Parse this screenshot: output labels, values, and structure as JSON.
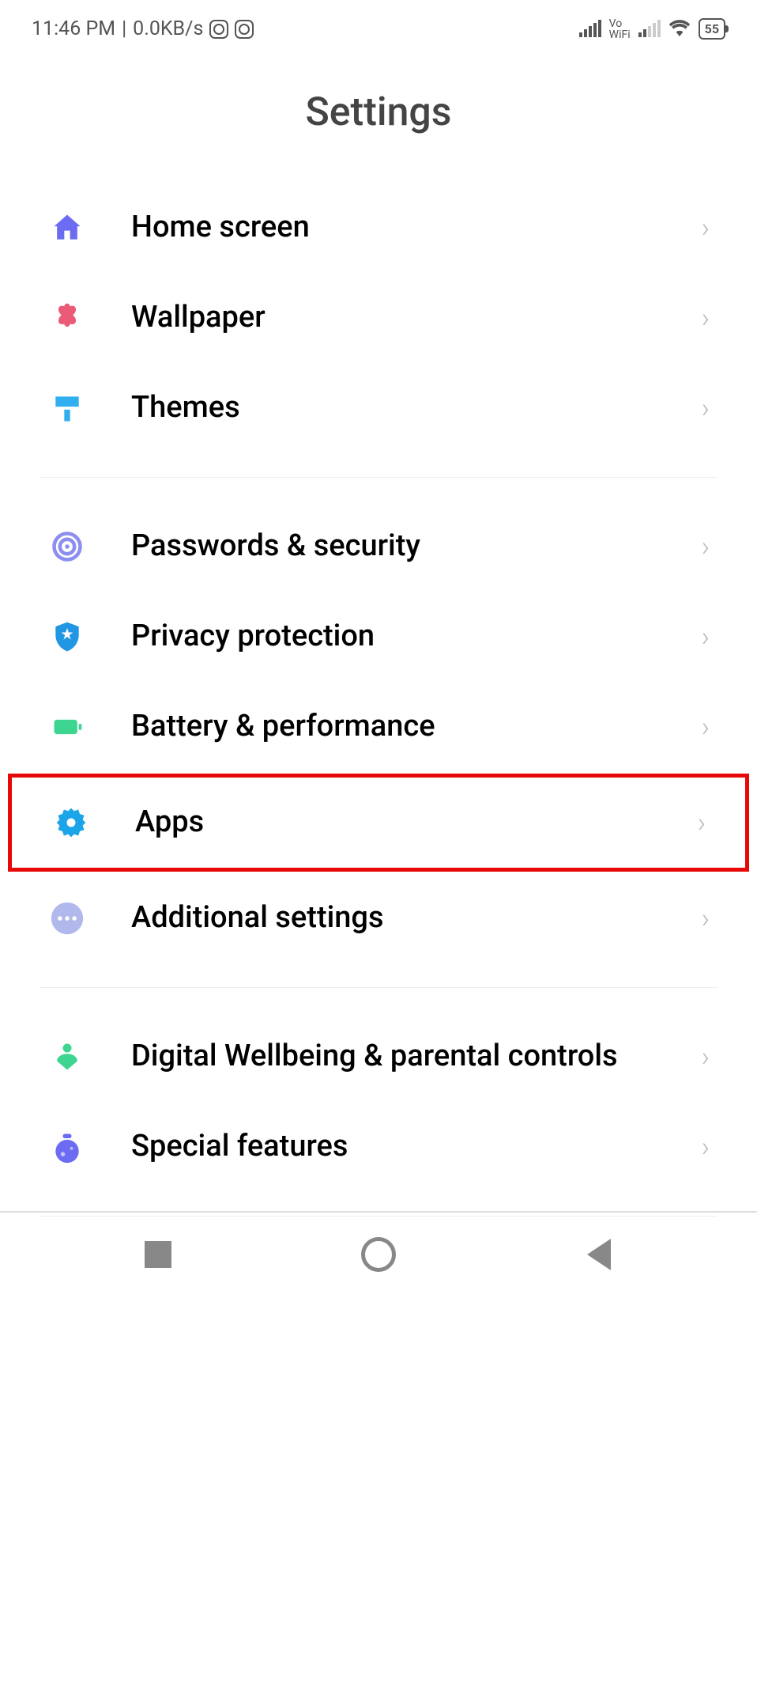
{
  "status_bar": {
    "time": "11:46 PM",
    "data_rate": "0.0KB/s",
    "vowifi_top": "Vo",
    "vowifi_bottom": "WiFi",
    "battery": "55"
  },
  "page_title": "Settings",
  "groups": [
    {
      "items": [
        {
          "id": "home-screen",
          "label": "Home screen",
          "icon": "home",
          "color": "#6b6cf2"
        },
        {
          "id": "wallpaper",
          "label": "Wallpaper",
          "icon": "flower",
          "color": "#eb5b78"
        },
        {
          "id": "themes",
          "label": "Themes",
          "icon": "brush",
          "color": "#31aef0"
        }
      ]
    },
    {
      "items": [
        {
          "id": "passwords-security",
          "label": "Passwords & security",
          "icon": "fingerprint",
          "color": "#8c8ef1"
        },
        {
          "id": "privacy-protection",
          "label": "Privacy protection",
          "icon": "shield",
          "color": "#2196e3"
        },
        {
          "id": "battery-performance",
          "label": "Battery & performance",
          "icon": "battery",
          "color": "#3dd590"
        },
        {
          "id": "apps",
          "label": "Apps",
          "icon": "gear",
          "color": "#1ba4e8",
          "highlighted": true
        },
        {
          "id": "additional-settings",
          "label": "Additional settings",
          "icon": "dots",
          "color": "#b0b8ec"
        }
      ]
    },
    {
      "items": [
        {
          "id": "digital-wellbeing",
          "label": "Digital Wellbeing & parental controls",
          "icon": "person",
          "color": "#3dd590"
        },
        {
          "id": "special-features",
          "label": "Special features",
          "icon": "flask",
          "color": "#6b6cf2"
        }
      ]
    }
  ]
}
